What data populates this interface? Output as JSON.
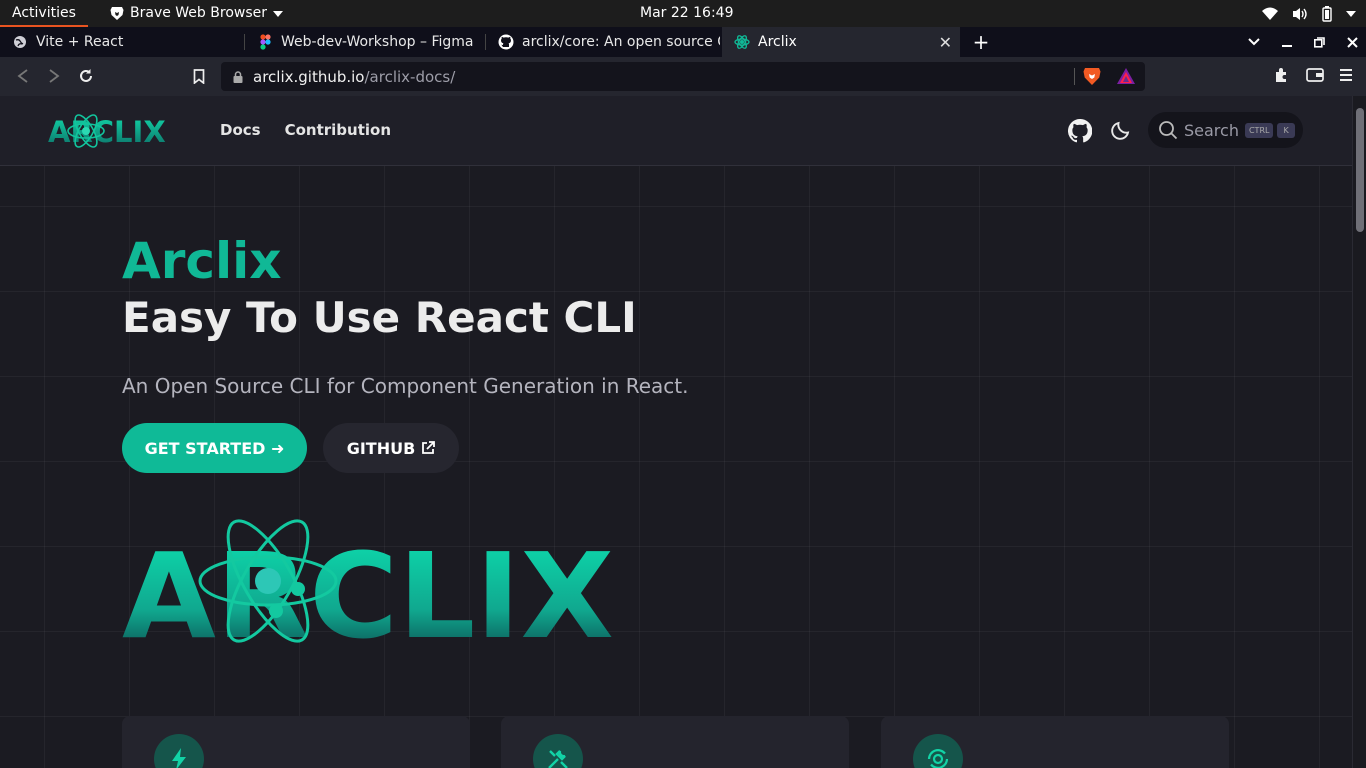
{
  "system": {
    "activities": "Activities",
    "app_menu": "Brave Web Browser",
    "clock": "Mar 22  16:49"
  },
  "tabs": [
    {
      "title": "Vite + React",
      "icon": "globe-icon"
    },
    {
      "title": "Web-dev-Workshop – Figma",
      "icon": "figma-icon"
    },
    {
      "title": "arclix/core: An open source CLI",
      "icon": "github-icon"
    },
    {
      "title": "Arclix",
      "icon": "arclix-favicon",
      "active": true
    }
  ],
  "address": {
    "domain": "arclix.github.io",
    "path": "/arclix-docs/"
  },
  "site": {
    "logo_text": "ARCLIX",
    "nav": [
      "Docs",
      "Contribution"
    ],
    "search_label": "Search",
    "kbd_ctrl": "CTRL",
    "kbd_k": "K"
  },
  "hero": {
    "name": "Arclix",
    "tagline": "Easy To Use React CLI",
    "subtitle": "An Open Source CLI for Component Generation in React.",
    "primary_button": "GET STARTED ➜",
    "secondary_button": "GITHUB"
  },
  "colors": {
    "accent": "#0fba97",
    "background": "#1b1b22",
    "header": "#1f1f28"
  },
  "feature_icons": [
    "bolt-icon",
    "tools-icon",
    "cycle-gear-icon"
  ]
}
